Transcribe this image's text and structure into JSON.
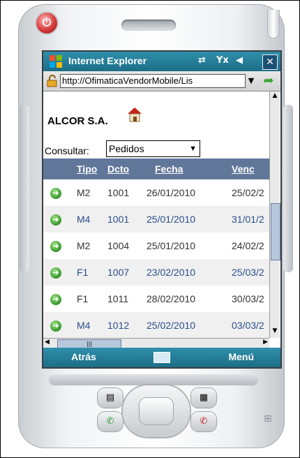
{
  "browser": {
    "title": "Internet Explorer",
    "url": "http://OfimaticaVendorMobile/Lis",
    "close_label": "✕"
  },
  "page": {
    "company": "ALCOR S.A.",
    "consult_label": "Consultar:",
    "consult_value": "Pedidos"
  },
  "table": {
    "headers": [
      "Tipo",
      "Dcto",
      "Fecha",
      "Venc"
    ],
    "rows": [
      {
        "tipo": "M2",
        "dcto": "1001",
        "fecha": "26/01/2010",
        "venc": "25/02/2"
      },
      {
        "tipo": "M4",
        "dcto": "1001",
        "fecha": "25/01/2010",
        "venc": "31/01/2"
      },
      {
        "tipo": "M2",
        "dcto": "1004",
        "fecha": "25/01/2010",
        "venc": "24/02/2"
      },
      {
        "tipo": "F1",
        "dcto": "1007",
        "fecha": "23/02/2010",
        "venc": "25/03/2"
      },
      {
        "tipo": "F1",
        "dcto": "1011",
        "fecha": "28/02/2010",
        "venc": "30/03/2"
      },
      {
        "tipo": "M4",
        "dcto": "1012",
        "fecha": "25/02/2010",
        "venc": "03/03/2"
      }
    ]
  },
  "softkeys": {
    "left": "Atrás",
    "right": "Menú"
  },
  "colors": {
    "bar": "#2f8fab",
    "table_header": "#61779a",
    "link": "#2a4f8c"
  }
}
